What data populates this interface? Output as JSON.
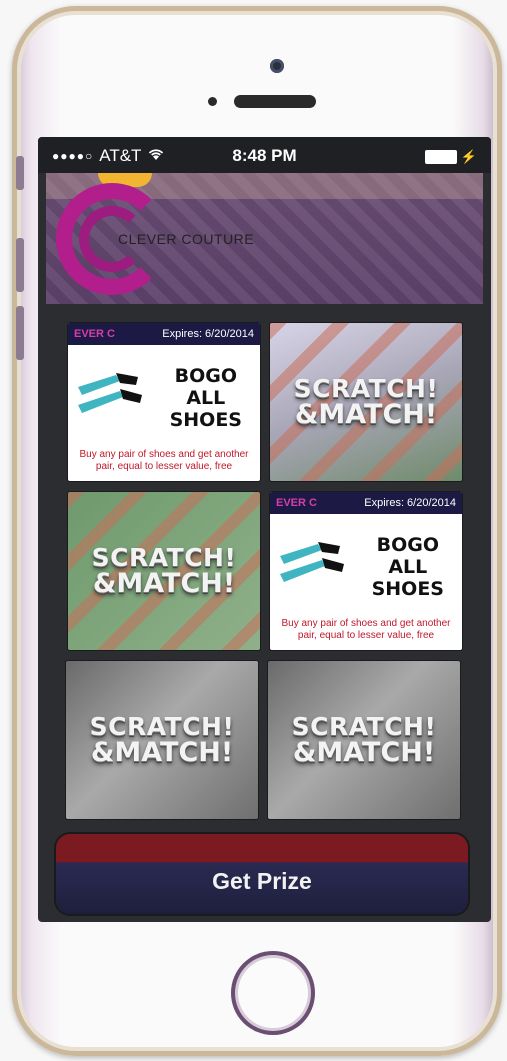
{
  "status_bar": {
    "carrier": "AT&T",
    "time": "8:48 PM",
    "signal_icon": "signal-dots-icon",
    "wifi_icon": "wifi-icon",
    "battery_icon": "battery-icon"
  },
  "header": {
    "brand": "CLEVER COUTURE",
    "logo_colors": {
      "ring": "#b21f8c",
      "accent": "#f2b532"
    }
  },
  "tiles": [
    {
      "kind": "coupon",
      "expires": "Expires: 6/20/2014",
      "brandmark": "EVER C",
      "line1": "BOGO",
      "line2": "ALL",
      "line3": "SHOES",
      "fine": "Buy any pair of shoes and get another pair, equal to lesser value, free"
    },
    {
      "kind": "scratch",
      "line1": "SCRATCH!",
      "line2": "&MATCH!"
    },
    {
      "kind": "scratch",
      "line1": "SCRATCH!",
      "line2": "&MATCH!"
    },
    {
      "kind": "coupon",
      "expires": "Expires: 6/20/2014",
      "brandmark": "EVER C",
      "line1": "BOGO",
      "line2": "ALL",
      "line3": "SHOES",
      "fine": "Buy any pair of shoes and get another pair, equal to lesser value, free"
    },
    {
      "kind": "scratch",
      "line1": "SCRATCH!",
      "line2": "&MATCH!"
    },
    {
      "kind": "scratch",
      "line1": "SCRATCH!",
      "line2": "&MATCH!"
    }
  ],
  "actions": {
    "get_prize_label": "Get Prize"
  }
}
